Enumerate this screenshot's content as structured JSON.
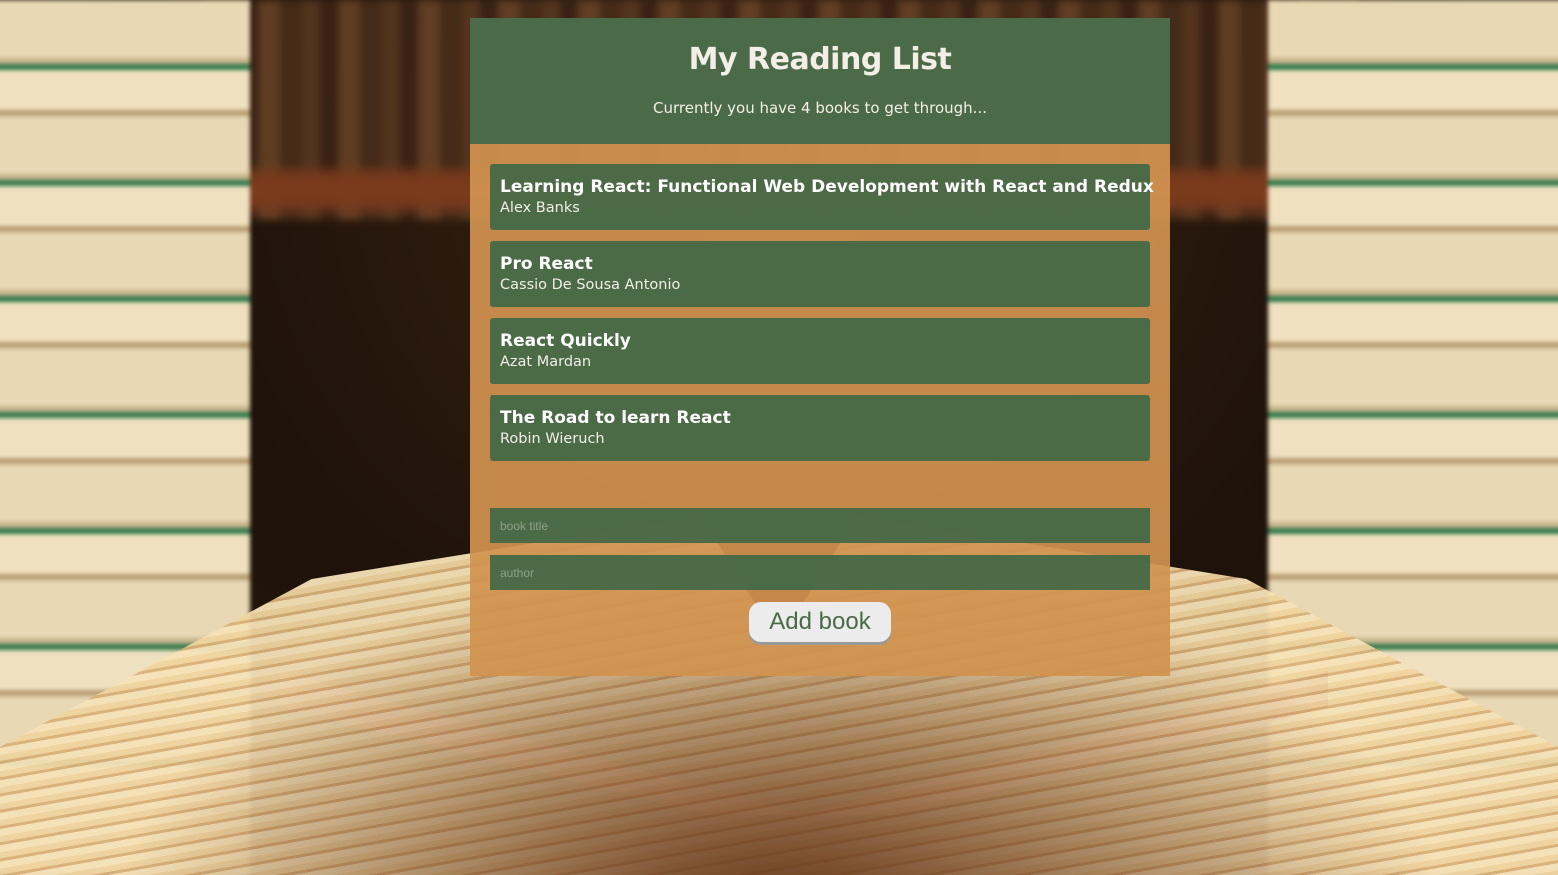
{
  "app": {
    "title": "My Reading List",
    "subtitle": "Currently you have 4 books to get through..."
  },
  "books": [
    {
      "title": "Learning React: Functional Web Development with React and Redux",
      "author": "Alex Banks"
    },
    {
      "title": "Pro React",
      "author": "Cassio De Sousa Antonio"
    },
    {
      "title": "React Quickly",
      "author": "Azat Mardan"
    },
    {
      "title": "The Road to learn React",
      "author": "Robin Wieruch"
    }
  ],
  "form": {
    "title_placeholder": "book title",
    "author_placeholder": "author",
    "submit_label": "Add book"
  },
  "colors": {
    "header_green": "#4b6a48",
    "card_orange": "#d19250",
    "button_bg": "#ececec"
  }
}
